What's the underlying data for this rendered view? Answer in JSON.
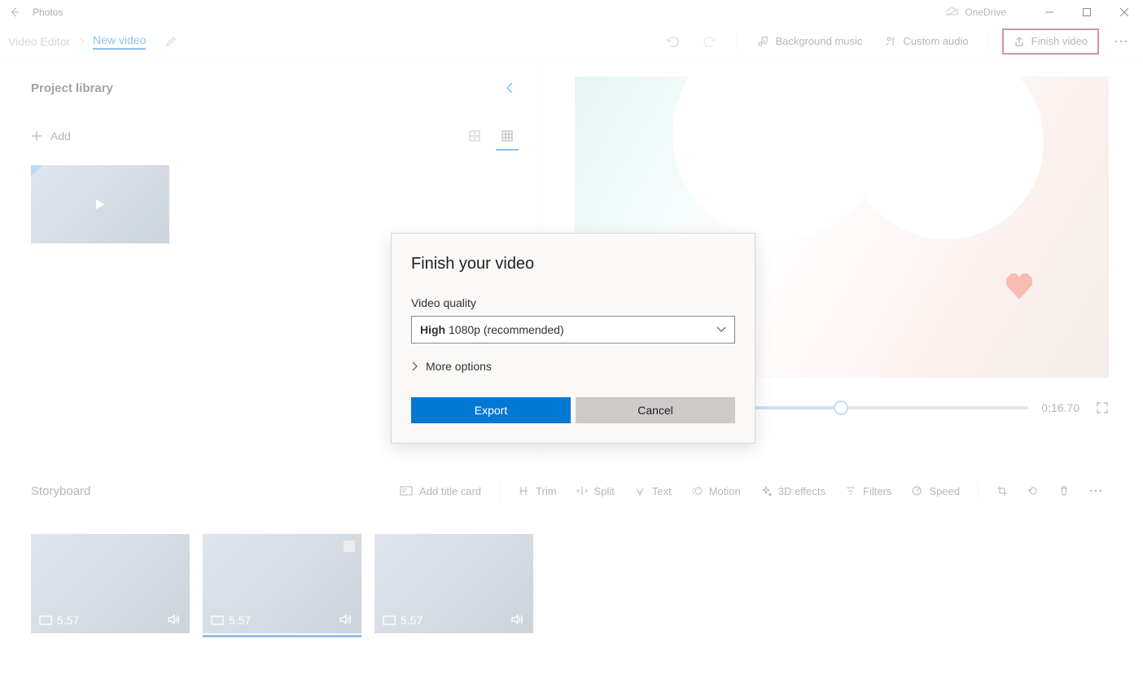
{
  "app_name": "Photos",
  "cloud_label": "OneDrive",
  "breadcrumb": {
    "root": "Video Editor",
    "current": "New video"
  },
  "header": {
    "bg_music": "Background music",
    "custom_audio": "Custom audio",
    "finish": "Finish video"
  },
  "library": {
    "title": "Project library",
    "add": "Add"
  },
  "player": {
    "time": "0:16.70"
  },
  "storyboard": {
    "title": "Storyboard",
    "add_title_card": "Add title card",
    "trim": "Trim",
    "split": "Split",
    "text": "Text",
    "motion": "Motion",
    "fx3d": "3D effects",
    "filters": "Filters",
    "speed": "Speed",
    "clips": [
      {
        "duration": "5.57",
        "selected": false
      },
      {
        "duration": "5.57",
        "selected": true
      },
      {
        "duration": "5.57",
        "selected": false
      }
    ]
  },
  "dialog": {
    "title": "Finish your video",
    "quality_label": "Video quality",
    "quality_bold": "High",
    "quality_rest": " 1080p (recommended)",
    "more": "More options",
    "export": "Export",
    "cancel": "Cancel"
  }
}
